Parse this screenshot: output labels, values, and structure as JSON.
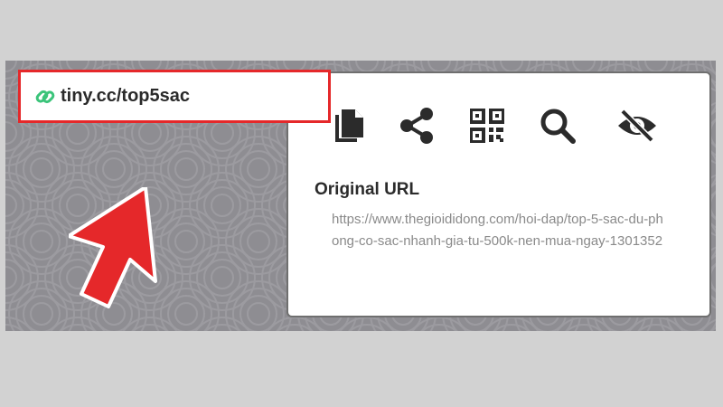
{
  "short_link": {
    "text": "tiny.cc/top5sac",
    "icon": "link-icon",
    "icon_color": "#3bc47a",
    "highlight_color": "#e5282a"
  },
  "actions": [
    {
      "icon": "copy-icon"
    },
    {
      "icon": "share-icon"
    },
    {
      "icon": "qr-code-icon"
    },
    {
      "icon": "search-icon"
    },
    {
      "icon": "eye-off-icon"
    }
  ],
  "original": {
    "label": "Original URL",
    "url": "https://www.thegioididong.com/hoi-dap/top-5-sac-du-phong-co-sac-nhanh-gia-tu-500k-nen-mua-ngay-1301352"
  },
  "colors": {
    "background": "#8e8d92",
    "arrow": "#e5282a"
  }
}
